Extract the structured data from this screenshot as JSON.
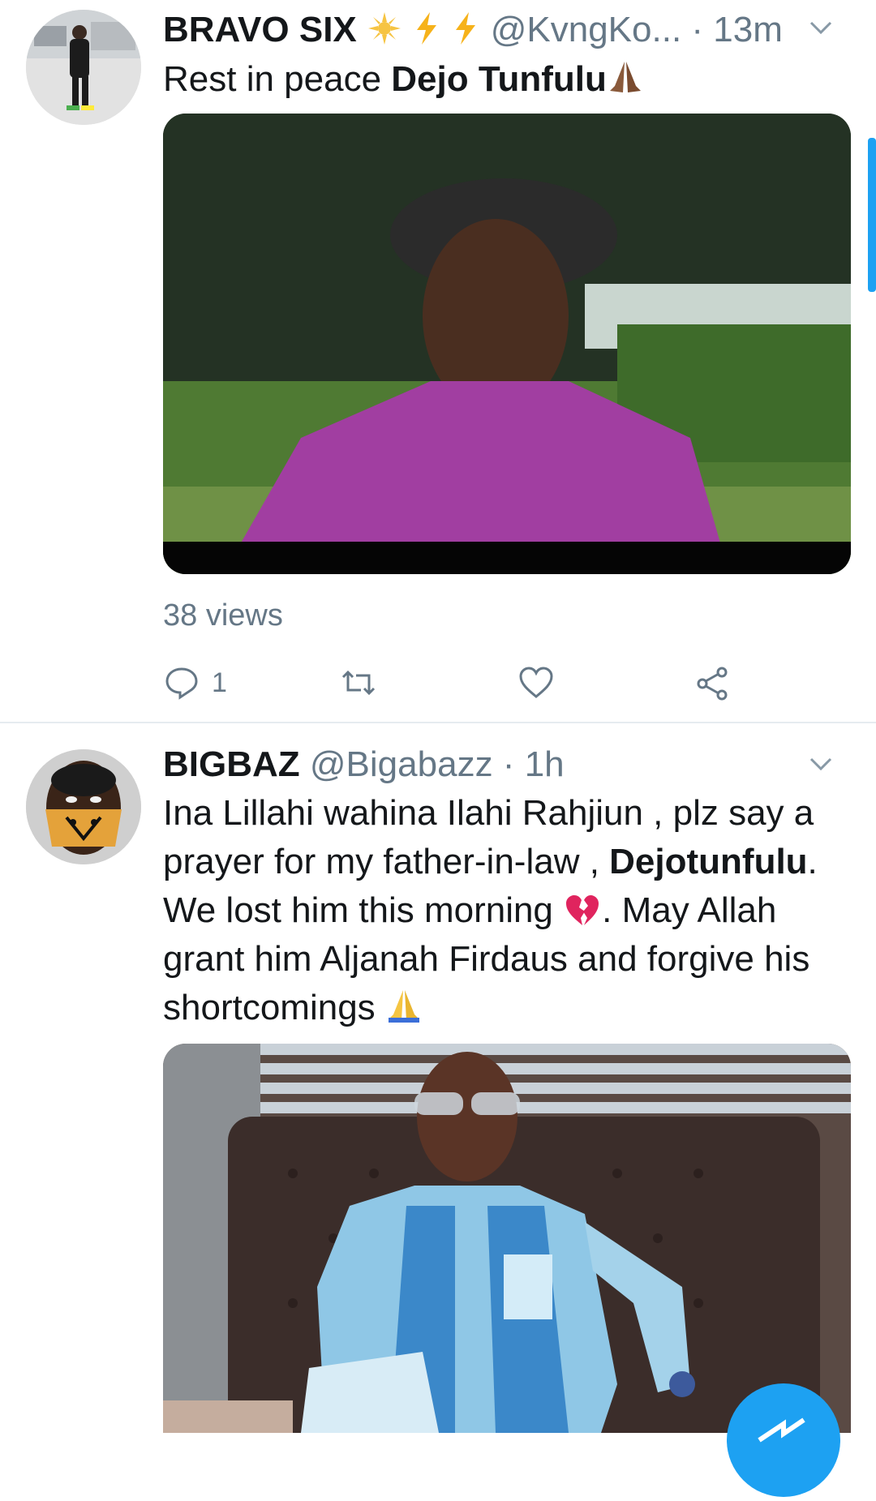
{
  "tweets": [
    {
      "display_name": "BRAVO SIX",
      "emojis": [
        "sun-emoji",
        "lightning-emoji",
        "lightning-emoji"
      ],
      "handle": "@KvngKo...",
      "dot": "·",
      "time": "13m",
      "text_plain": "Rest in peace ",
      "text_bold": "Dejo Tunfulu",
      "text_emoji": "praying-hands-emoji",
      "views": "38 views",
      "reply_count": "1",
      "icons": [
        "reply-icon",
        "retweet-icon",
        "like-icon",
        "share-icon"
      ]
    },
    {
      "display_name": "BIGBAZ",
      "handle": "@Bigabazz",
      "dot": "·",
      "time": "1h",
      "text_1": "Ina Lillahi wahina Ilahi Rahjiun , plz say a prayer for my father-in-law , ",
      "text_bold": "Dejotunfulu",
      "text_2": ". We lost him this morning ",
      "text_3": ". May Allah grant him Aljanah Firdaus and forgive his shortcomings ",
      "emojis": [
        "broken-heart-emoji",
        "praying-hands-emoji"
      ]
    }
  ],
  "colors": {
    "accent": "#1da1f2",
    "muted": "#657786",
    "text": "#14171a",
    "divider": "#e6ecf0"
  }
}
